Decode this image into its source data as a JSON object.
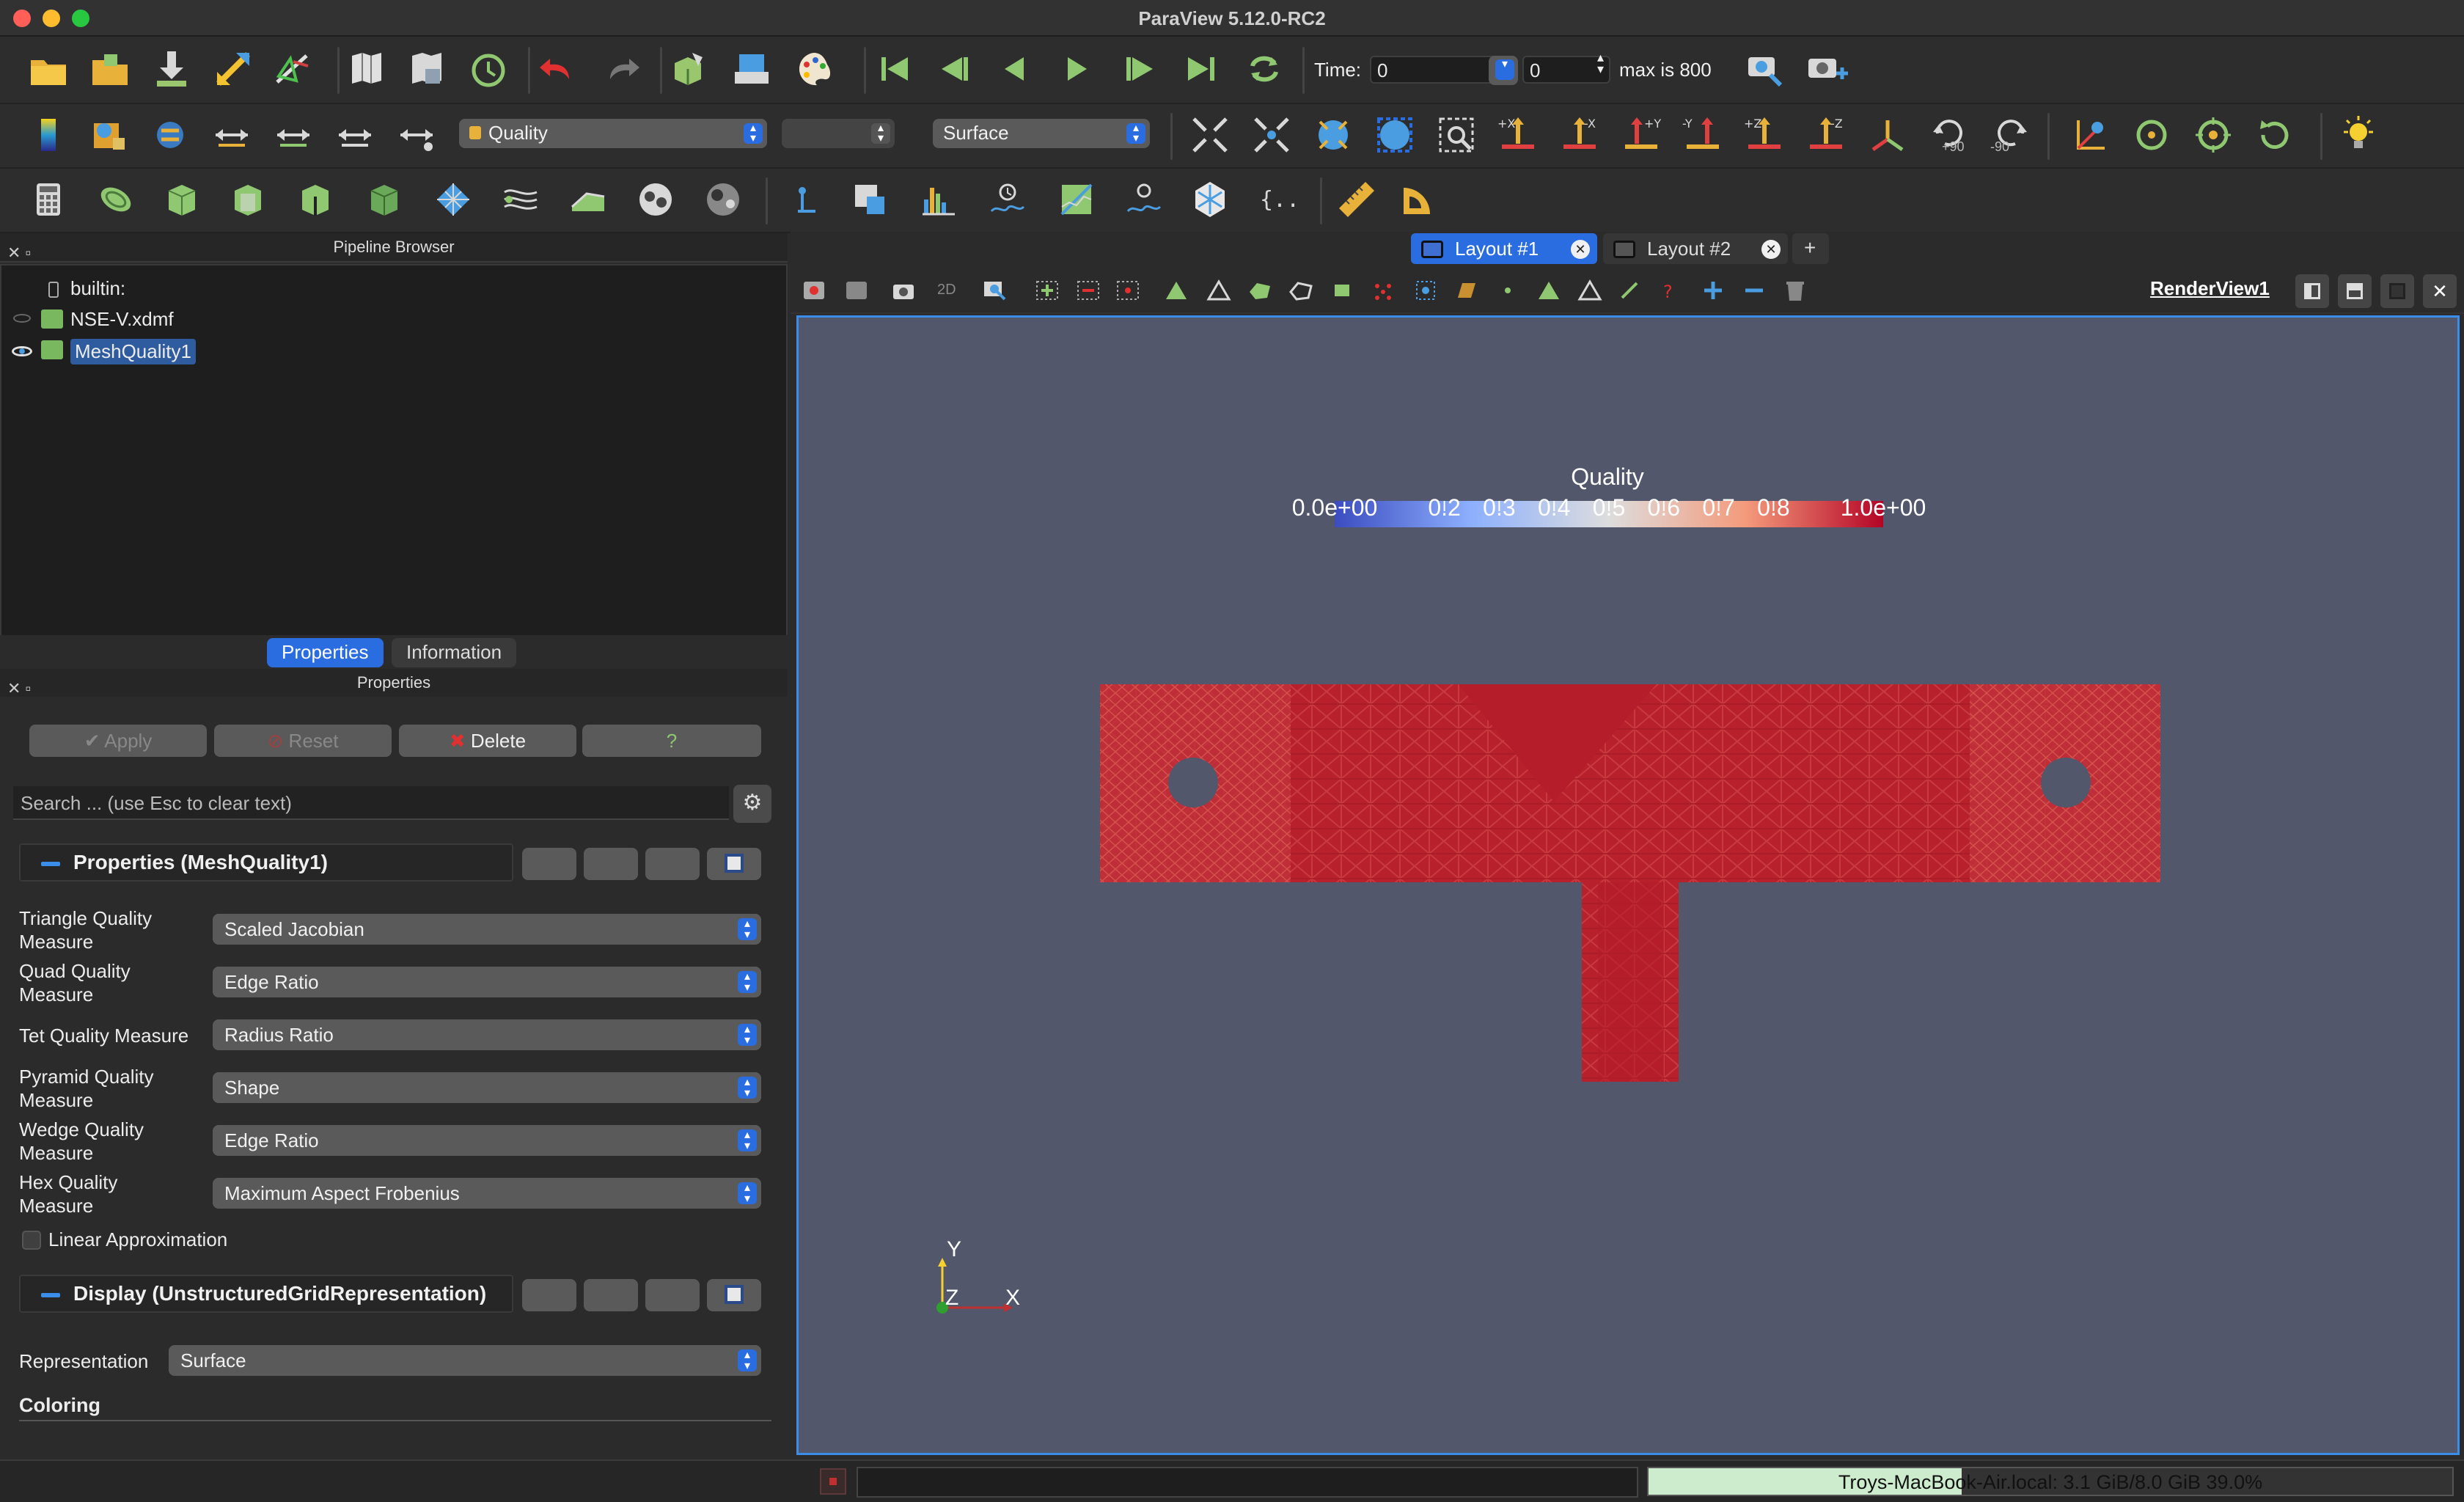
{
  "window": {
    "title": "ParaView 5.12.0-RC2"
  },
  "toolbar_main": {
    "time_label": "Time:",
    "time_value": "0",
    "timestep_value": "0",
    "max_text": "max is 800"
  },
  "toolbar_second": {
    "color_by": "Quality",
    "component": "",
    "representation": "Surface",
    "rotate_plus": "+90",
    "rotate_minus": "-90",
    "axes": [
      "+X",
      "-X",
      "+Y",
      "-Y",
      "+Z",
      "-Z"
    ]
  },
  "pipeline_browser": {
    "header": "Pipeline Browser",
    "items": [
      "builtin:",
      "NSE-V.xdmf",
      "MeshQuality1"
    ]
  },
  "left_tabs": {
    "properties": "Properties",
    "information": "Information"
  },
  "properties_panel": {
    "header": "Properties",
    "apply": "Apply",
    "reset": "Reset",
    "delete": "Delete",
    "help": "?",
    "search_placeholder": "Search ... (use Esc to clear text)",
    "section_properties": "Properties (MeshQuality1)",
    "section_display": "Display (UnstructuredGridRepresentation)",
    "rows": [
      {
        "label": "Triangle Quality\nMeasure",
        "value": "Scaled Jacobian"
      },
      {
        "label": "Quad Quality\nMeasure",
        "value": "Edge Ratio"
      },
      {
        "label": "Tet Quality Measure",
        "value": "Radius Ratio"
      },
      {
        "label": "Pyramid Quality\nMeasure",
        "value": "Shape"
      },
      {
        "label": "Wedge Quality\nMeasure",
        "value": "Edge Ratio"
      },
      {
        "label": "Hex Quality\nMeasure",
        "value": "Maximum Aspect Frobenius"
      }
    ],
    "linear_approx": "Linear Approximation",
    "representation_label": "Representation",
    "representation_value": "Surface",
    "coloring_label": "Coloring"
  },
  "layouts": {
    "tab1": "Layout #1",
    "tab2": "Layout #2",
    "add": "+"
  },
  "view": {
    "name": "RenderView1",
    "mode_2d": "2D",
    "colorbar_title": "Quality",
    "colorbar_ticks": [
      "0.0e+00",
      "0.2",
      "0.3",
      "0.4",
      "0.5",
      "0.6",
      "0.7",
      "0.8",
      "1.0e+00"
    ],
    "axes_labels": {
      "x": "X",
      "y": "Y",
      "z": "Z"
    }
  },
  "status": {
    "memory_text": "Troys-MacBook-Air.local: 3.1 GiB/8.0 GiB 39.0%",
    "memory_fraction": 0.39
  }
}
